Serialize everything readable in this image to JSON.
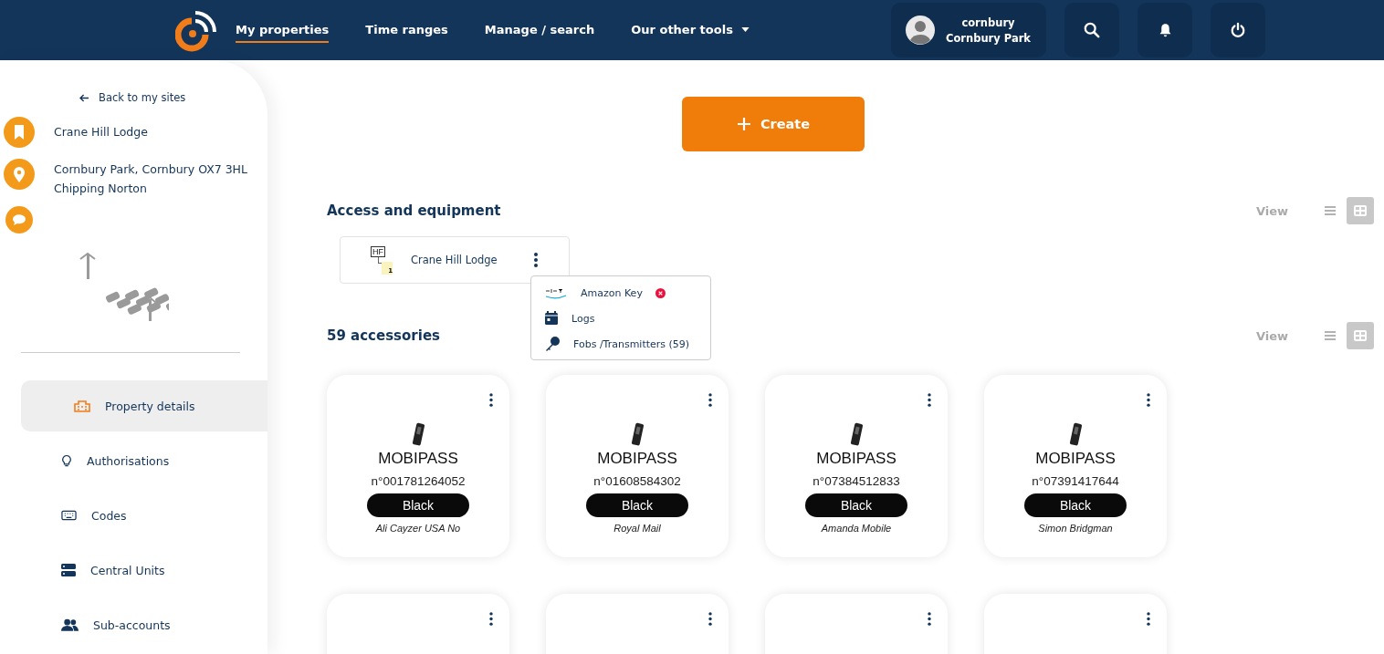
{
  "nav": {
    "items": [
      {
        "label": "My properties",
        "selected": true
      },
      {
        "label": "Time ranges",
        "selected": false
      },
      {
        "label": "Manage / search",
        "selected": false
      },
      {
        "label": "Our other tools",
        "selected": false,
        "dropdown": true
      }
    ],
    "user": {
      "username": "cornbury",
      "site": "Cornbury Park"
    }
  },
  "sidebar": {
    "back": "Back to my sites",
    "name": "Crane Hill Lodge",
    "address": [
      "Cornbury Park, Cornbury OX7 3HL",
      "Chipping Norton"
    ],
    "items": [
      {
        "label": "Property details",
        "selected": true
      },
      {
        "label": "Authorisations",
        "selected": false
      },
      {
        "label": "Codes",
        "selected": false
      },
      {
        "label": "Central Units",
        "selected": false
      },
      {
        "label": "Sub-accounts",
        "selected": false
      }
    ]
  },
  "create": "Create",
  "equipment": {
    "title": "Access and equipment",
    "view_label": "View",
    "views": [
      {
        "selected": false
      },
      {
        "selected": true
      }
    ],
    "items": [
      {
        "type": "HF",
        "count": "1",
        "name": "Crane Hill Lodge"
      }
    ],
    "menu": [
      {
        "label": "Amazon Key",
        "error": true
      },
      {
        "label": "Logs",
        "error": false
      },
      {
        "label": "Fobs /Transmitters (59)",
        "error": false
      }
    ]
  },
  "accessories": {
    "title": "59 accessories",
    "view_label": "View",
    "views": [
      {
        "selected": false
      },
      {
        "selected": true
      }
    ],
    "items": [
      {
        "kind": "full",
        "model": "MOBIPASS",
        "number": "n°001781264052",
        "color_label": "Black",
        "owner": "Ali Cayzer USA No"
      },
      {
        "kind": "full",
        "model": "MOBIPASS",
        "number": "n°01608584302",
        "color_label": "Black",
        "owner": "Royal Mail"
      },
      {
        "kind": "full",
        "model": "MOBIPASS",
        "number": "n°07384512833",
        "color_label": "Black",
        "owner": "Amanda Mobile"
      },
      {
        "kind": "full",
        "model": "MOBIPASS",
        "number": "n°07391417644",
        "color_label": "Black",
        "owner": "Simon Bridgman"
      },
      {
        "kind": "partial"
      },
      {
        "kind": "partial"
      },
      {
        "kind": "partial"
      },
      {
        "kind": "partial"
      }
    ]
  }
}
